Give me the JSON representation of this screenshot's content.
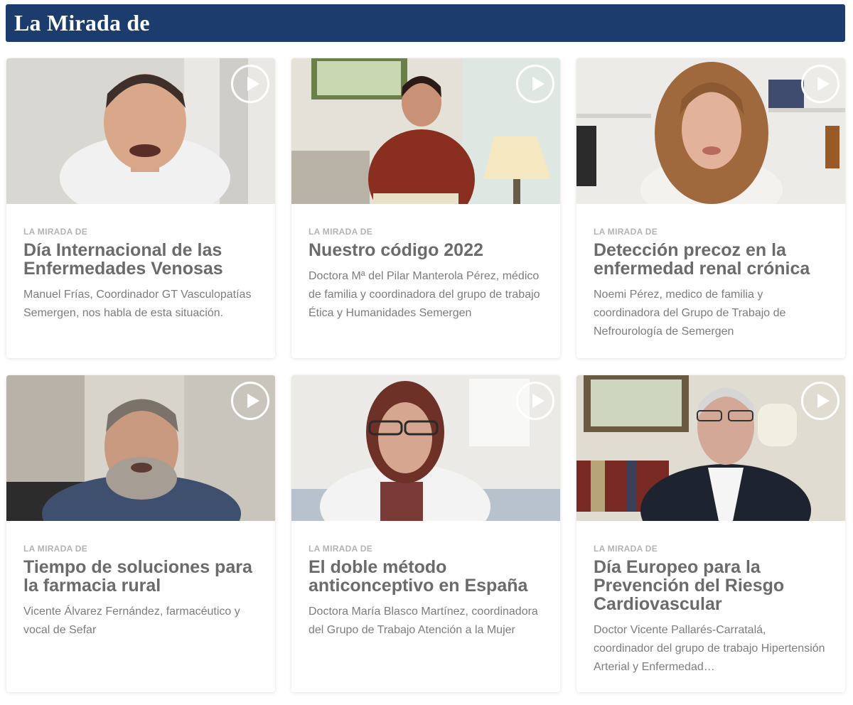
{
  "header": {
    "title": "La Mirada de"
  },
  "cards": [
    {
      "category": "LA MIRADA DE",
      "title": "Día Internacional de las Enfermedades Venosas",
      "description": "Manuel Frías, Coordinador GT Vasculopatías Semergen, nos habla de esta situación.",
      "play_icon": "play-icon"
    },
    {
      "category": "LA MIRADA DE",
      "title": "Nuestro código 2022",
      "description": "Doctora Mª del Pilar Manterola Pérez, médico de familia y coordinadora del grupo de trabajo Ética y Humanidades Semergen",
      "play_icon": "play-icon"
    },
    {
      "category": "LA MIRADA DE",
      "title": "Detección precoz en la enfermedad renal crónica",
      "description": "Noemi Pérez, medico de familia y coordinadora del Grupo de Trabajo de Nefrourología de Semergen",
      "play_icon": "play-icon"
    },
    {
      "category": "LA MIRADA DE",
      "title": "Tiempo de soluciones para la farmacia rural",
      "description": "Vicente Álvarez Fernández, farmacéutico y vocal de Sefar",
      "play_icon": "play-icon"
    },
    {
      "category": "LA MIRADA DE",
      "title": "El doble método anticonceptivo en España",
      "description": "Doctora María Blasco Martínez, coordinadora del Grupo de Trabajo Atención a la Mujer",
      "play_icon": "play-icon"
    },
    {
      "category": "LA MIRADA DE",
      "title": "Día Europeo para la Prevención del Riesgo Cardiovascular",
      "description": "Doctor Vicente Pallarés-Carratalá, coordinador del grupo de trabajo Hipertensión Arterial y Enfermedad…",
      "play_icon": "play-icon"
    }
  ],
  "colors": {
    "header_bg": "#1b3c6c",
    "header_text": "#ffffff",
    "title_text": "#6b6b6b",
    "category_text": "#b3b3b3"
  }
}
